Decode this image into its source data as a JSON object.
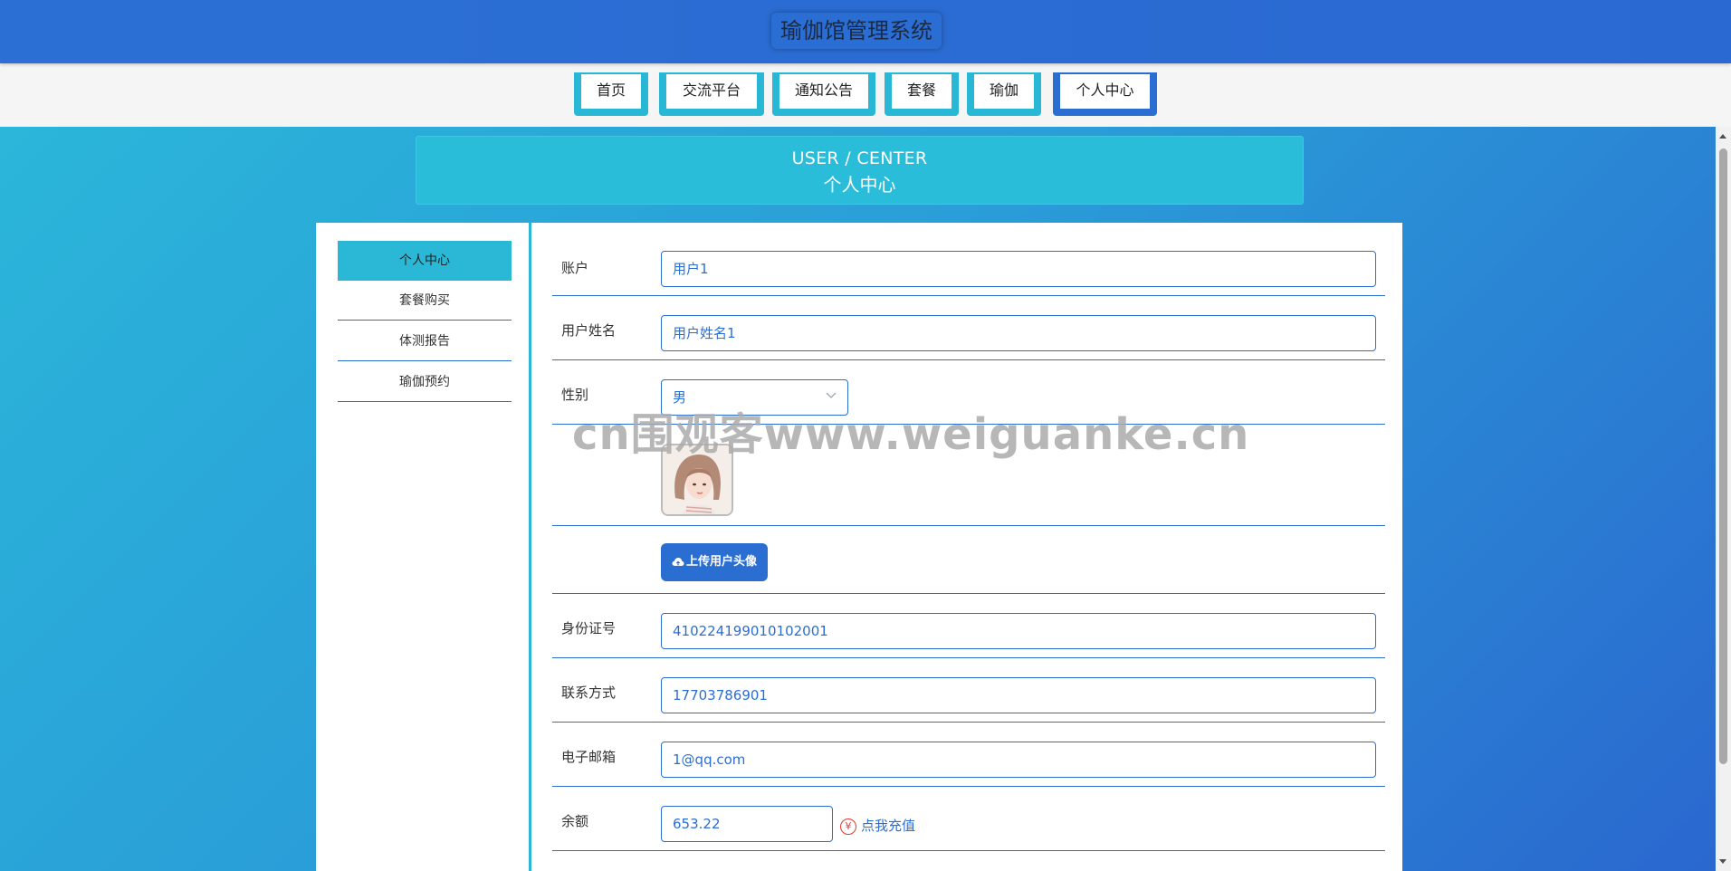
{
  "header": {
    "title": "瑜伽馆管理系统"
  },
  "nav": {
    "items": [
      "首页",
      "交流平台",
      "通知公告",
      "套餐",
      "瑜伽",
      "个人中心"
    ],
    "active": "个人中心"
  },
  "banner": {
    "en": "USER / CENTER",
    "cn": "个人中心"
  },
  "sidebar": {
    "items": [
      "个人中心",
      "套餐购买",
      "体测报告",
      "瑜伽预约"
    ],
    "active": "个人中心"
  },
  "form": {
    "account": {
      "label": "账户",
      "value": "用户1"
    },
    "name": {
      "label": "用户姓名",
      "value": "用户姓名1"
    },
    "gender": {
      "label": "性别",
      "value": "男"
    },
    "upload": {
      "label": "上传用户头像"
    },
    "id_card": {
      "label": "身份证号",
      "value": "410224199010102001"
    },
    "phone": {
      "label": "联系方式",
      "value": "17703786901"
    },
    "email": {
      "label": "电子邮箱",
      "value": "1@qq.com"
    },
    "balance": {
      "label": "余额",
      "value": "653.22",
      "recharge": "点我充值"
    }
  },
  "watermark": "cn围观客www.weiguanke.cn",
  "colors": {
    "primary": "#2b6ed2",
    "accent": "#2bb8d6",
    "danger": "#e53935"
  }
}
